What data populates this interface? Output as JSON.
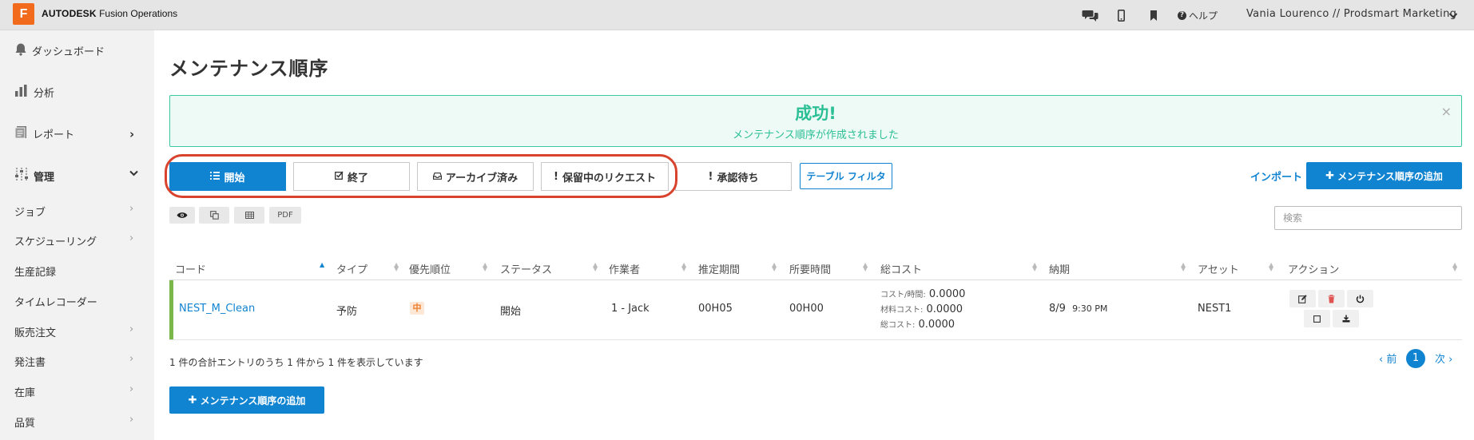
{
  "topbar": {
    "logo_letter": "F",
    "brand_bold": "AUTODESK",
    "brand_rest": " Fusion Operations",
    "help_label": "ヘルプ",
    "user_label": "Vania Lourenco // Prodsmart Marketing"
  },
  "sidebar": {
    "main_items": [
      {
        "label": "ダッシュボード",
        "icon": "bell-icon"
      },
      {
        "label": "分析",
        "icon": "bar-chart-icon"
      },
      {
        "label": "レポート",
        "icon": "report-icon"
      },
      {
        "label": "管理",
        "icon": "sliders-icon"
      }
    ],
    "sub_items": [
      {
        "label": "ジョブ"
      },
      {
        "label": "スケジューリング"
      },
      {
        "label": "生産記録"
      },
      {
        "label": "タイムレコーダー"
      },
      {
        "label": "販売注文"
      },
      {
        "label": "発注書"
      },
      {
        "label": "在庫"
      },
      {
        "label": "品質"
      }
    ]
  },
  "page": {
    "title": "メンテナンス順序"
  },
  "alert": {
    "title": "成功!",
    "message": "メンテナンス順序が作成されました",
    "close": "×"
  },
  "tabs": [
    {
      "label": "開始",
      "icon": "list-icon"
    },
    {
      "label": "終了",
      "icon": "check-square-icon"
    },
    {
      "label": "アーカイブ済み",
      "icon": "inbox-icon"
    },
    {
      "label": "保留中のリクエスト",
      "icon": "exclamation-icon"
    },
    {
      "label": "承認待ち",
      "icon": "exclamation-icon"
    }
  ],
  "toolbar": {
    "table_filter": "テーブル フィルタ",
    "import": "インポート",
    "add_maintenance": "メンテナンス順序の追加",
    "pdf": "PDF"
  },
  "search": {
    "placeholder": "検索"
  },
  "table": {
    "headers": [
      "コード",
      "タイプ",
      "優先順位",
      "ステータス",
      "作業者",
      "推定期間",
      "所要時間",
      "総コスト",
      "納期",
      "アセット",
      "アクション"
    ],
    "rows": [
      {
        "code": "NEST_M_Clean",
        "type": "予防",
        "priority": "中",
        "status": "開始",
        "worker": "1 - Jack",
        "estimated": "00H05",
        "elapsed": "00H00",
        "cost_per_hour_label": "コスト/時間:",
        "cost_per_hour": "0.0000",
        "material_cost_label": "材料コスト:",
        "material_cost": "0.0000",
        "total_cost_label": "総コスト:",
        "total_cost": "0.0000",
        "due_date": "8/9",
        "due_time": "9:30 PM",
        "asset": "NEST1"
      }
    ]
  },
  "footer": {
    "info": "1 件の合計エントリのうち 1 件から 1 件を表示しています",
    "prev": "‹ 前",
    "page": "1",
    "next": "次 ›"
  },
  "colors": {
    "primary": "#1184d1",
    "success": "#2bbf96",
    "accent_logo": "#f26b1d",
    "row_accent": "#7ab648",
    "highlight_circle": "#d9432e"
  }
}
